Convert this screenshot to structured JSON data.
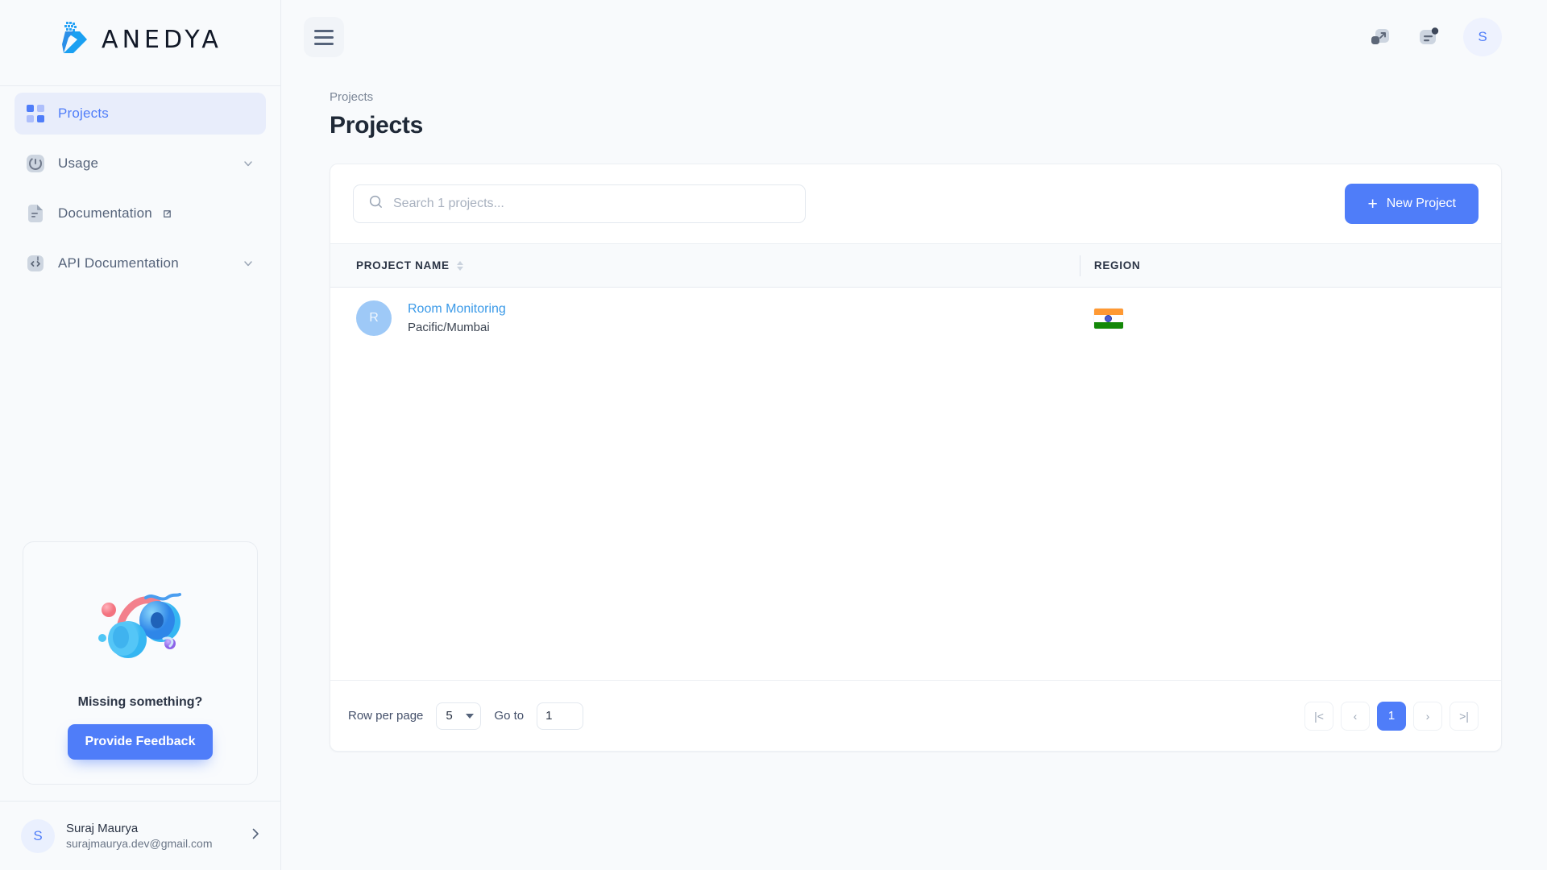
{
  "brand": {
    "name": "ANEDYA",
    "logo_icon": "anedya-arrow-logo",
    "accent": "#4f7df9",
    "logo_blue": "#2196f3"
  },
  "sidebar": {
    "items": [
      {
        "label": "Projects",
        "icon": "grid-icon",
        "active": true,
        "chevron": false,
        "external": false
      },
      {
        "label": "Usage",
        "icon": "gauge-icon",
        "active": false,
        "chevron": true,
        "external": false
      },
      {
        "label": "Documentation",
        "icon": "document-icon",
        "active": false,
        "chevron": false,
        "external": true
      },
      {
        "label": "API Documentation",
        "icon": "code-icon",
        "active": false,
        "chevron": true,
        "external": false
      }
    ],
    "feedback": {
      "illustration_icon": "headphones-3d-illustration",
      "title": "Missing something?",
      "button_label": "Provide Feedback"
    },
    "user": {
      "avatar_initial": "S",
      "name": "Suraj Maurya",
      "email": "surajmaurya.dev@gmail.com",
      "chevron_icon": "chevron-right-icon"
    }
  },
  "topbar": {
    "menu_icon": "hamburger-menu-icon",
    "actions": [
      {
        "icon": "external-link-icon",
        "badge": false
      },
      {
        "icon": "notifications-icon",
        "badge": true
      }
    ],
    "avatar_initial": "S"
  },
  "page": {
    "breadcrumb": "Projects",
    "title": "Projects"
  },
  "toolbar": {
    "search_placeholder": "Search 1 projects...",
    "search_value": "",
    "search_icon": "search-icon",
    "new_project_label": "New Project",
    "plus_icon": "plus-icon"
  },
  "table": {
    "columns": [
      {
        "label": "PROJECT NAME",
        "sortable": true,
        "sort_icon": "sort-updown-icon"
      },
      {
        "label": "REGION",
        "sortable": false
      }
    ],
    "rows": [
      {
        "avatar_initial": "R",
        "name": "Room Monitoring",
        "timezone": "Pacific/Mumbai",
        "region_flag": "india-flag-icon"
      }
    ]
  },
  "footer": {
    "rows_per_page_label": "Row per page",
    "rows_per_page_value": "5",
    "goto_label": "Go to",
    "goto_value": "1",
    "pagination": [
      {
        "label": "|<",
        "name": "first-page",
        "active": false
      },
      {
        "label": "‹",
        "name": "prev-page",
        "active": false
      },
      {
        "label": "1",
        "name": "page-1",
        "active": true
      },
      {
        "label": "›",
        "name": "next-page",
        "active": false
      },
      {
        "label": ">|",
        "name": "last-page",
        "active": false
      }
    ]
  }
}
